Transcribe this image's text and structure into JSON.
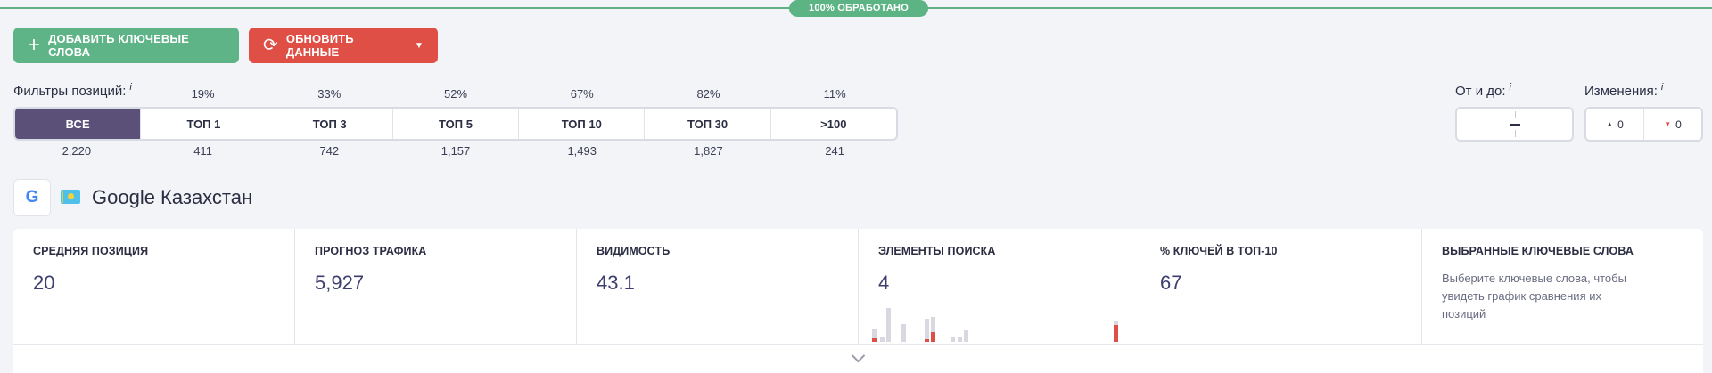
{
  "progress": {
    "label": "100% ОБРАБОТАНО",
    "value": 1.0
  },
  "toolbar": {
    "add_label": "ДОБАВИТЬ КЛЮЧЕВЫЕ СЛОВА",
    "refresh_label": "ОБНОВИТЬ ДАННЫЕ"
  },
  "filters": {
    "label": "Фильтры позиций:",
    "info": "i",
    "segments": [
      {
        "label": "ВСЕ",
        "percent": "",
        "count": "2,220",
        "active": true
      },
      {
        "label": "ТОП 1",
        "percent": "19%",
        "count": "411"
      },
      {
        "label": "ТОП 3",
        "percent": "33%",
        "count": "742"
      },
      {
        "label": "ТОП 5",
        "percent": "52%",
        "count": "1,157"
      },
      {
        "label": "ТОП 10",
        "percent": "67%",
        "count": "1,493"
      },
      {
        "label": "ТОП 30",
        "percent": "82%",
        "count": "1,827"
      },
      {
        "label": ">100",
        "percent": "11%",
        "count": "241"
      }
    ]
  },
  "range": {
    "label": "От и до:",
    "info": "i",
    "separator": "–"
  },
  "changes": {
    "label": "Изменения:",
    "info": "i",
    "up": "0",
    "down": "0"
  },
  "engine": {
    "icon_letter": "G",
    "name": "Google Казахстан"
  },
  "stats": [
    {
      "title": "СРЕДНЯЯ ПОЗИЦИЯ",
      "value": "20"
    },
    {
      "title": "ПРОГНОЗ ТРАФИКА",
      "value": "5,927"
    },
    {
      "title": "ВИДИМОСТЬ",
      "value": "43.1"
    },
    {
      "title": "ЭЛЕМЕНТЫ ПОИСКА",
      "value": "4"
    },
    {
      "title": "% КЛЮЧЕЙ В ТОП-10",
      "value": "67"
    },
    {
      "title": "ВЫБРАННЫЕ КЛЮЧЕВЫЕ СЛОВА",
      "description": "Выберите ключевые слова, чтобы увидеть график сравнения их позиций"
    }
  ],
  "colors": {
    "accent_green": "#5eb487",
    "accent_red": "#df4f45",
    "active_segment": "#5a5078"
  }
}
